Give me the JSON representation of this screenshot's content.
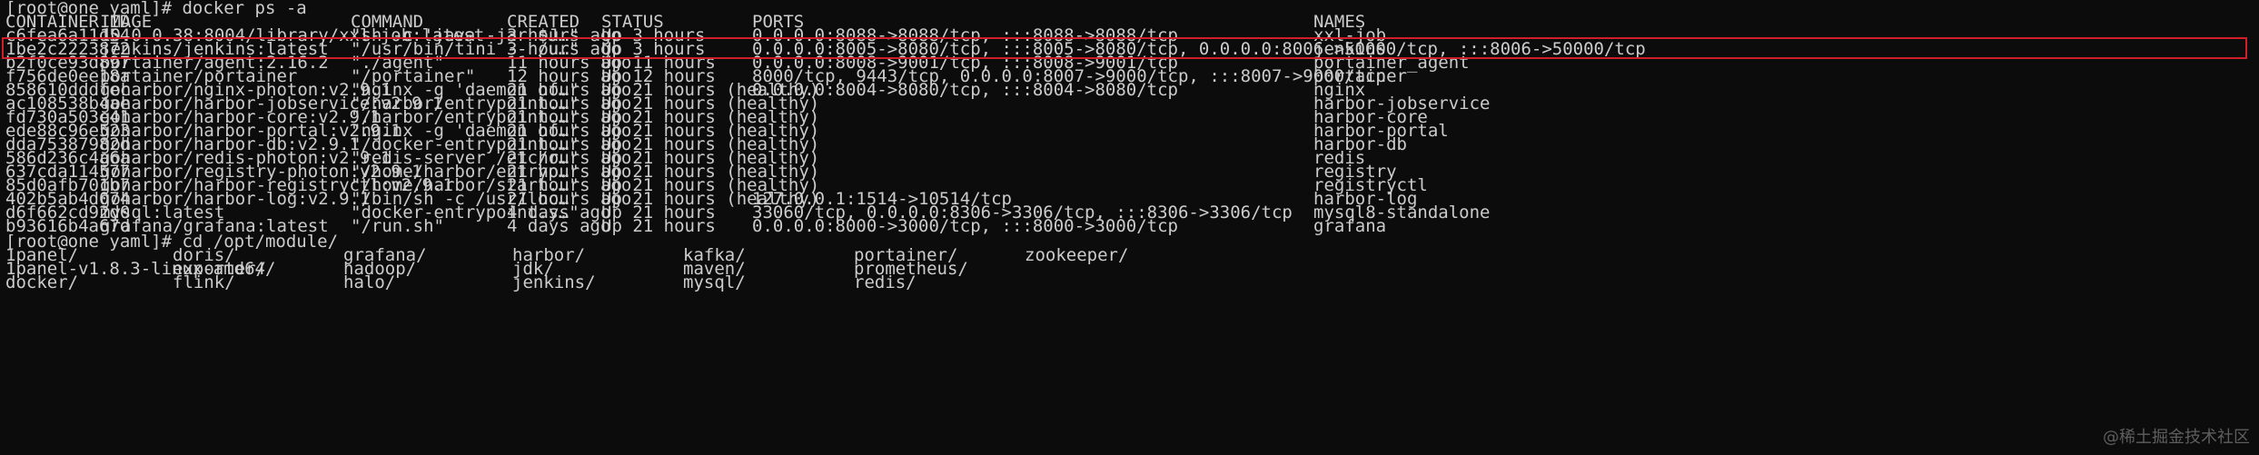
{
  "prompt1": "[root@one yaml]# docker ps -a",
  "headers": {
    "container_id": "CONTAINER ID",
    "image": "IMAGE",
    "command": "COMMAND",
    "created": "CREATED",
    "status": "STATUS",
    "ports": "PORTS",
    "names": "NAMES"
  },
  "rows": [
    {
      "id": "c6fea6a11d54",
      "image": "10.0.0.38:8004/library/xxl-job:latest",
      "command": "\"sh -c 'java -jar $J…\"",
      "created": "3 hours ago",
      "status": "Up 3 hours",
      "ports": "0.0.0.0:8088->8088/tcp, :::8088->8088/tcp",
      "name": "xxl-job"
    },
    {
      "id": "1be2c2223872",
      "image": "jenkins/jenkins:latest",
      "command": "\"/usr/bin/tini -- /u…\"",
      "created": "3 hours ago",
      "status": "Up 3 hours",
      "ports": "0.0.0.0:8005->8080/tcp, :::8005->8080/tcp, 0.0.0.0:8006->50000/tcp, :::8006->50000/tcp",
      "name": "jenkins"
    },
    {
      "id": "b2f0ce93d897",
      "image": "portainer/agent:2.16.2",
      "command": "\"./agent\"",
      "created": "11 hours ago",
      "status": "Up 11 hours",
      "ports": "0.0.0.0:8008->9001/tcp, :::8008->9001/tcp",
      "name": "portainer_agent"
    },
    {
      "id": "f756de0ee18a",
      "image": "portainer/portainer",
      "command": "\"/portainer\"",
      "created": "12 hours ago",
      "status": "Up 12 hours",
      "ports": "8000/tcp, 9443/tcp, 0.0.0.0:8007->9000/tcp, :::8007->9000/tcp",
      "name": "portainer"
    },
    {
      "id": "858610dddfec",
      "image": "goharbor/nginx-photon:v2.9.1",
      "command": "\"nginx -g 'daemon of…\"",
      "created": "21 hours ago",
      "status": "Up 21 hours (healthy)",
      "ports": "0.0.0.0:8004->8080/tcp, :::8004->8080/tcp",
      "name": "nginx"
    },
    {
      "id": "ac108538b4ae",
      "image": "goharbor/harbor-jobservice:v2.9.1",
      "command": "\"/harbor/entrypoint.…\"",
      "created": "21 hours ago",
      "status": "Up 21 hours (healthy)",
      "ports": "",
      "name": "harbor-jobservice"
    },
    {
      "id": "fd730a503e41",
      "image": "goharbor/harbor-core:v2.9.1",
      "command": "\"/harbor/entrypoint.…\"",
      "created": "21 hours ago",
      "status": "Up 21 hours (healthy)",
      "ports": "",
      "name": "harbor-core"
    },
    {
      "id": "ede88c96e523",
      "image": "goharbor/harbor-portal:v2.9.1",
      "command": "\"nginx -g 'daemon of…\"",
      "created": "21 hours ago",
      "status": "Up 21 hours (healthy)",
      "ports": "",
      "name": "harbor-portal"
    },
    {
      "id": "dda75387982d",
      "image": "goharbor/harbor-db:v2.9.1",
      "command": "\"/docker-entrypoint.…\"",
      "created": "21 hours ago",
      "status": "Up 21 hours (healthy)",
      "ports": "",
      "name": "harbor-db"
    },
    {
      "id": "586d236c4a6a",
      "image": "goharbor/redis-photon:v2.9.1",
      "command": "\"redis-server /etc/r…\"",
      "created": "21 hours ago",
      "status": "Up 21 hours (healthy)",
      "ports": "",
      "name": "redis"
    },
    {
      "id": "637cda114577",
      "image": "goharbor/registry-photon:v2.9.1",
      "command": "\"/home/harbor/entryp…\"",
      "created": "21 hours ago",
      "status": "Up 21 hours (healthy)",
      "ports": "",
      "name": "registry"
    },
    {
      "id": "85d0afb701b7",
      "image": "goharbor/harbor-registryctl:v2.9.1",
      "command": "\"/home/harbor/start.…\"",
      "created": "21 hours ago",
      "status": "Up 21 hours (healthy)",
      "ports": "",
      "name": "registryctl"
    },
    {
      "id": "402b5ab4d074",
      "image": "goharbor/harbor-log:v2.9.1",
      "command": "\"/bin/sh -c /usr/loc…\"",
      "created": "21 hours ago",
      "status": "Up 21 hours (healthy)",
      "ports": "127.0.0.1:1514->10514/tcp",
      "name": "harbor-log"
    },
    {
      "id": "d6f662cd92d0",
      "image": "mysql:latest",
      "command": "\"docker-entrypoint.s…\"",
      "created": "4 days ago",
      "status": "Up 21 hours",
      "ports": "33060/tcp, 0.0.0.0:8306->3306/tcp, :::8306->3306/tcp",
      "name": "mysql8-standalone"
    },
    {
      "id": "b93616b4a67d",
      "image": "grafana/grafana:latest",
      "command": "\"/run.sh\"",
      "created": "4 days ago",
      "status": "Up 21 hours",
      "ports": "0.0.0.0:8000->3000/tcp, :::8000->3000/tcp",
      "name": "grafana"
    }
  ],
  "prompt2": "[root@one yaml]# cd /opt/module/",
  "dirs": [
    [
      "1panel/",
      "doris/",
      "grafana/",
      "harbor/",
      "kafka/",
      "portainer/",
      "zookeeper/"
    ],
    [
      "1panel-v1.8.3-linux-amd64/",
      "exporter/",
      "hadoop/",
      "jdk/",
      "maven/",
      "prometheus/",
      ""
    ],
    [
      "docker/",
      "flink/",
      "halo/",
      "jenkins/",
      "mysql/",
      "redis/",
      ""
    ]
  ],
  "watermark": "@稀土掘金技术社区"
}
